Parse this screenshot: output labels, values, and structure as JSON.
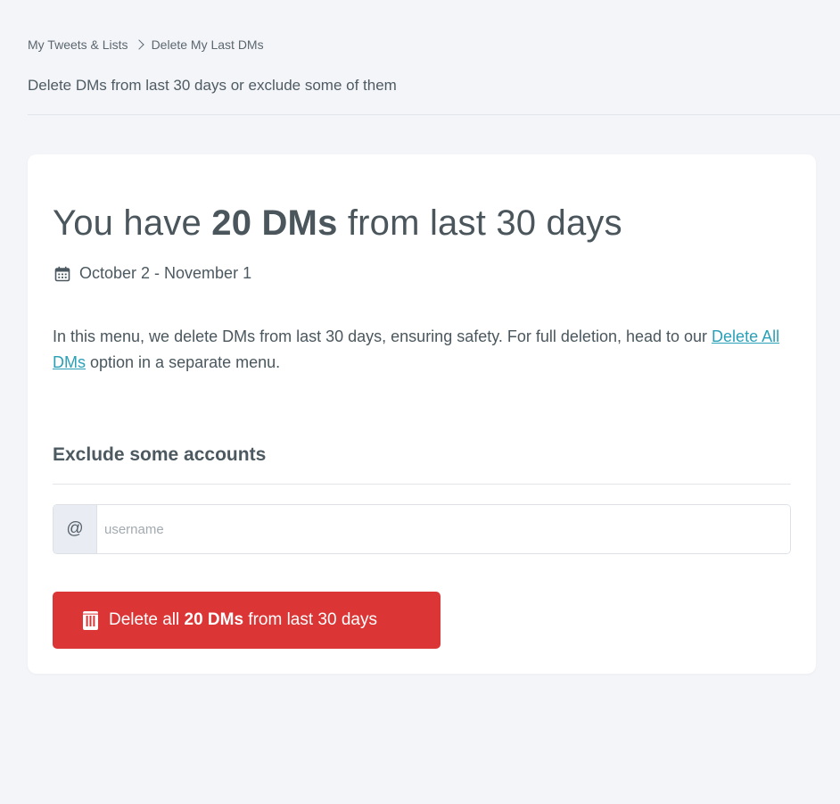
{
  "breadcrumb": {
    "items": [
      "My Tweets & Lists",
      "Delete My Last DMs"
    ]
  },
  "page": {
    "subtitle": "Delete DMs from last 30 days or exclude some of them"
  },
  "card": {
    "title_prefix": "You have ",
    "title_count": "20 DMs",
    "title_suffix": " from last 30 days",
    "date_range": "October 2 - November 1",
    "description_text": "In this menu, we delete DMs from last 30 days, ensuring safety. For full deletion, head to our ",
    "description_link": "Delete All DMs",
    "description_suffix": " option in a separate menu."
  },
  "exclude": {
    "title": "Exclude some accounts",
    "prefix": "@",
    "placeholder": "username",
    "value": ""
  },
  "delete_button": {
    "label_prefix": "Delete all ",
    "label_count": "20 DMs",
    "label_suffix": " from last 30 days"
  },
  "colors": {
    "background": "#f4f5f9",
    "card": "#ffffff",
    "danger": "#db3535",
    "link": "#2aa0b7",
    "text": "#4a565c"
  },
  "icons": {
    "calendar": "calendar-icon",
    "chevron": "chevron-right-icon",
    "trash": "trash-icon"
  }
}
